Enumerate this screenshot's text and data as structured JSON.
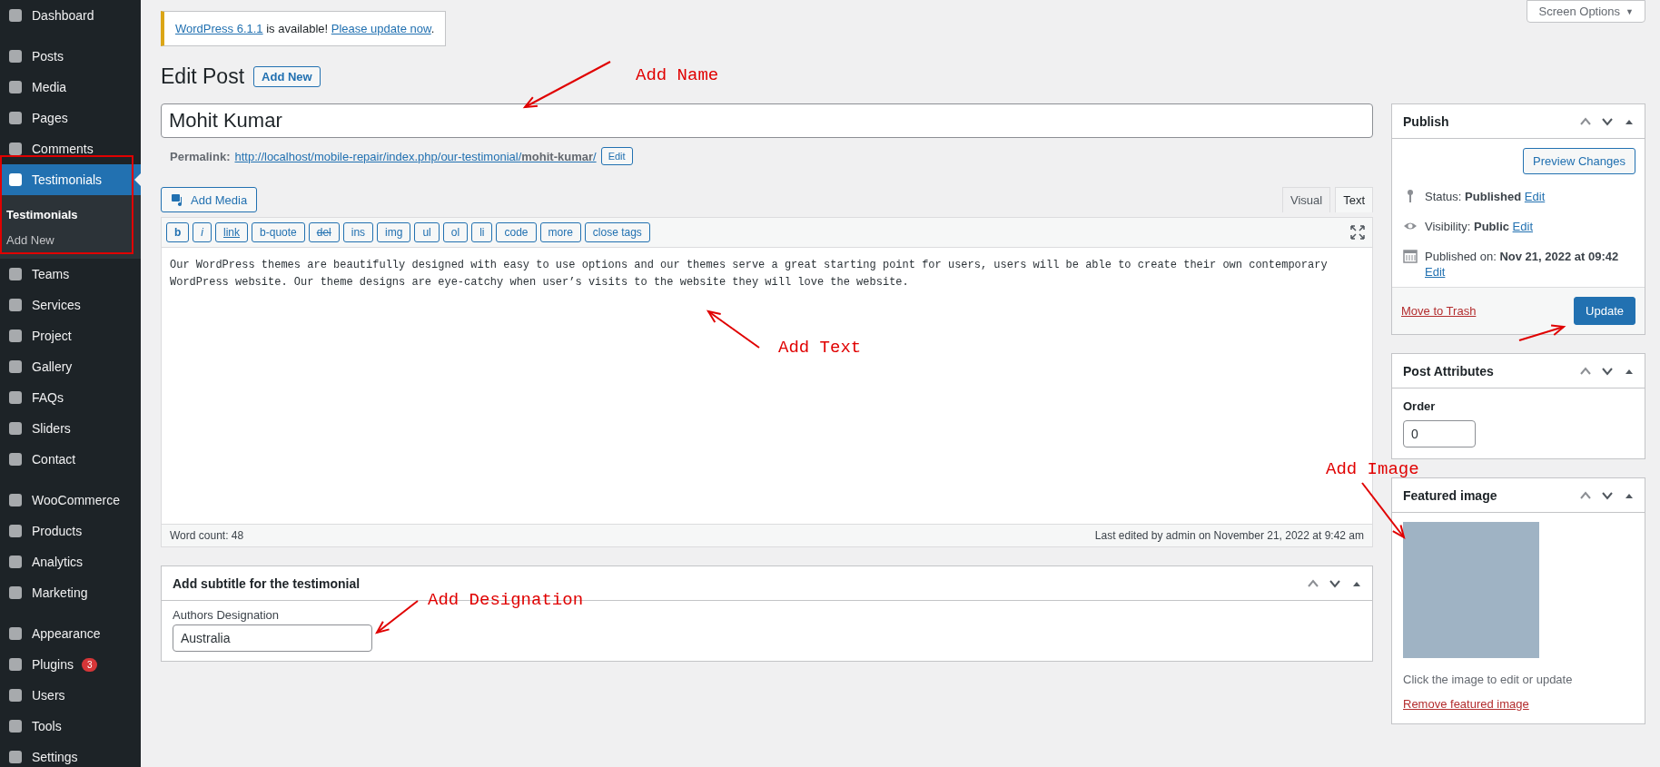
{
  "sidebar": {
    "sections": [
      [
        {
          "label": "Dashboard",
          "selected": false
        }
      ],
      [
        {
          "label": "Posts",
          "selected": false
        },
        {
          "label": "Media",
          "selected": false
        },
        {
          "label": "Pages",
          "selected": false
        },
        {
          "label": "Comments",
          "selected": false
        },
        {
          "label": "Testimonials",
          "selected": true,
          "submenu": [
            {
              "label": "Testimonials",
              "selected": true
            },
            {
              "label": "Add New",
              "selected": false
            }
          ]
        },
        {
          "label": "Teams",
          "selected": false
        },
        {
          "label": "Services",
          "selected": false
        },
        {
          "label": "Project",
          "selected": false
        },
        {
          "label": "Gallery",
          "selected": false
        },
        {
          "label": "FAQs",
          "selected": false
        },
        {
          "label": "Sliders",
          "selected": false
        },
        {
          "label": "Contact",
          "selected": false
        }
      ],
      [
        {
          "label": "WooCommerce",
          "selected": false
        },
        {
          "label": "Products",
          "selected": false
        },
        {
          "label": "Analytics",
          "selected": false
        },
        {
          "label": "Marketing",
          "selected": false
        }
      ],
      [
        {
          "label": "Appearance",
          "selected": false
        },
        {
          "label": "Plugins",
          "selected": false,
          "badge": "3"
        },
        {
          "label": "Users",
          "selected": false
        },
        {
          "label": "Tools",
          "selected": false
        },
        {
          "label": "Settings",
          "selected": false
        }
      ]
    ]
  },
  "screen_options": {
    "label": "Screen Options",
    "caret": "▼"
  },
  "notice": {
    "version_link": "WordPress 6.1.1",
    "middle": " is available! ",
    "update_link": "Please update now",
    "end": "."
  },
  "page_title": "Edit Post",
  "add_new": "Add New",
  "post_title": "Mohit Kumar",
  "permalink": {
    "label": "Permalink:",
    "url": "http://localhost/mobile-repair/index.php/our-testimonial/**mohit-kumar**/",
    "edit": "Edit"
  },
  "editor": {
    "add_media": "Add Media",
    "tabs": [
      {
        "label": "Visual",
        "selected": false
      },
      {
        "label": "Text",
        "selected": true
      }
    ],
    "quicktags": [
      {
        "label": "b",
        "kind": "bold"
      },
      {
        "label": "i",
        "kind": "italic"
      },
      {
        "label": "link",
        "kind": "underline"
      },
      {
        "label": "b-quote",
        "kind": "plain"
      },
      {
        "label": "del",
        "kind": "strike"
      },
      {
        "label": "ins",
        "kind": "plain"
      },
      {
        "label": "img",
        "kind": "plain"
      },
      {
        "label": "ul",
        "kind": "plain"
      },
      {
        "label": "ol",
        "kind": "plain"
      },
      {
        "label": "li",
        "kind": "plain"
      },
      {
        "label": "code",
        "kind": "plain"
      },
      {
        "label": "more",
        "kind": "plain"
      },
      {
        "label": "close tags",
        "kind": "plain"
      }
    ],
    "content": "Our WordPress themes are beautifully designed with easy to use options and our themes serve a great starting point for users, users will be able to create their own contemporary WordPress website. Our theme designs are eye-catchy when user’s visits to the website they will love the website.",
    "word_count": "Word count: 48",
    "last_edited": "Last edited by admin on November 21, 2022 at 9:42 am"
  },
  "subtitle_box": {
    "title": "Add subtitle for the testimonial",
    "field_label": "Authors Designation",
    "value": "Australia"
  },
  "publish": {
    "title": "Publish",
    "preview": "Preview Changes",
    "rows": [
      {
        "kind": "status",
        "label": "Status:",
        "value": "Published",
        "edit": "Edit"
      },
      {
        "kind": "visibility",
        "label": "Visibility:",
        "value": "Public",
        "edit": "Edit"
      },
      {
        "kind": "date",
        "label": "Published on:",
        "value": "Nov 21, 2022 at 09:42",
        "edit": "Edit"
      }
    ],
    "trash": "Move to Trash",
    "update": "Update"
  },
  "post_attributes": {
    "title": "Post Attributes",
    "order_label": "Order",
    "order_value": "0"
  },
  "featured_image": {
    "title": "Featured image",
    "hint": "Click the image to edit or update",
    "remove": "Remove featured image"
  },
  "annotations": [
    {
      "text": "Add Name"
    },
    {
      "text": "Add Text"
    },
    {
      "text": "Add Image"
    },
    {
      "text": "Add Designation"
    }
  ]
}
